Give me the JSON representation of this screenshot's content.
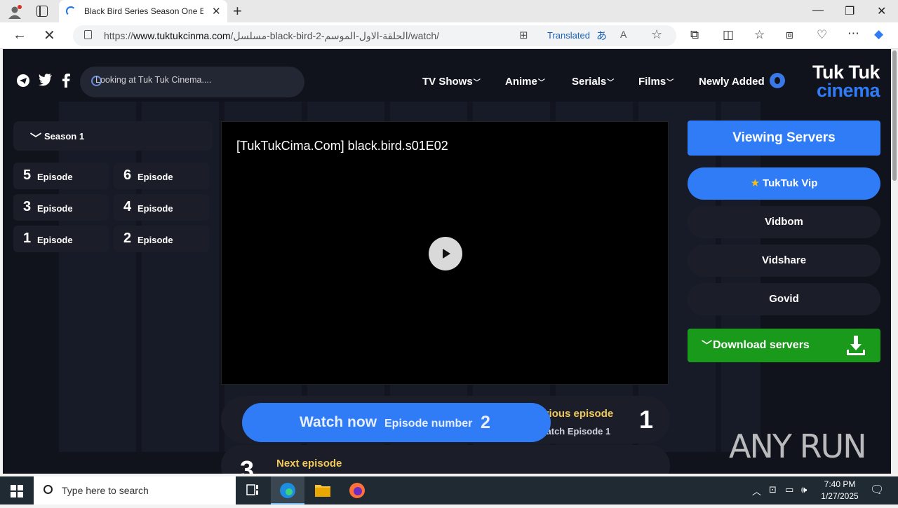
{
  "browser": {
    "tab_title": "Black Bird Series Season One Epi",
    "url_prefix": "https://",
    "url_domain": "www.tuktukcinma.com",
    "url_path": "/مسلسل-black-bird-2-الحلقة-الاول-الموسم/watch/",
    "translated_label": "Translated"
  },
  "site": {
    "search_placeholder": "Looking at Tuk Tuk Cinema....",
    "nav": [
      "TV Shows",
      "Anime",
      "Serials",
      "Films",
      "Newly Added"
    ],
    "logo_line1": "Tuk Tuk",
    "logo_line2": "cinema"
  },
  "sidebar": {
    "season_label": "Season 1",
    "episodes": [
      {
        "num": "5",
        "label": "Episode"
      },
      {
        "num": "6",
        "label": "Episode"
      },
      {
        "num": "3",
        "label": "Episode"
      },
      {
        "num": "4",
        "label": "Episode"
      },
      {
        "num": "1",
        "label": "Episode"
      },
      {
        "num": "2",
        "label": "Episode"
      }
    ]
  },
  "player": {
    "title": "[TukTukCima.Com] black.bird.s01E02"
  },
  "servers": {
    "heading": "Viewing Servers",
    "items": [
      "TukTuk Vip",
      "Vidbom",
      "Vidshare",
      "Govid"
    ],
    "download_label": "Download servers"
  },
  "episode_nav": {
    "watch_now": "Watch now",
    "episode_number_label": "Episode number",
    "current_episode": "2",
    "previous_label": "Previous episode",
    "previous_sub": "Download & Watch Episode 1",
    "previous_number": "1",
    "next_label": "Next episode",
    "next_number": "3"
  },
  "watermark": "ANY RUN",
  "taskbar": {
    "search_placeholder": "Type here to search",
    "time": "7:40 PM",
    "date": "1/27/2025"
  },
  "colors": {
    "accent_blue": "#2f7cf6",
    "download_green": "#1a9a1a",
    "page_bg": "#10131c",
    "highlight_yellow": "#f0c95a"
  }
}
